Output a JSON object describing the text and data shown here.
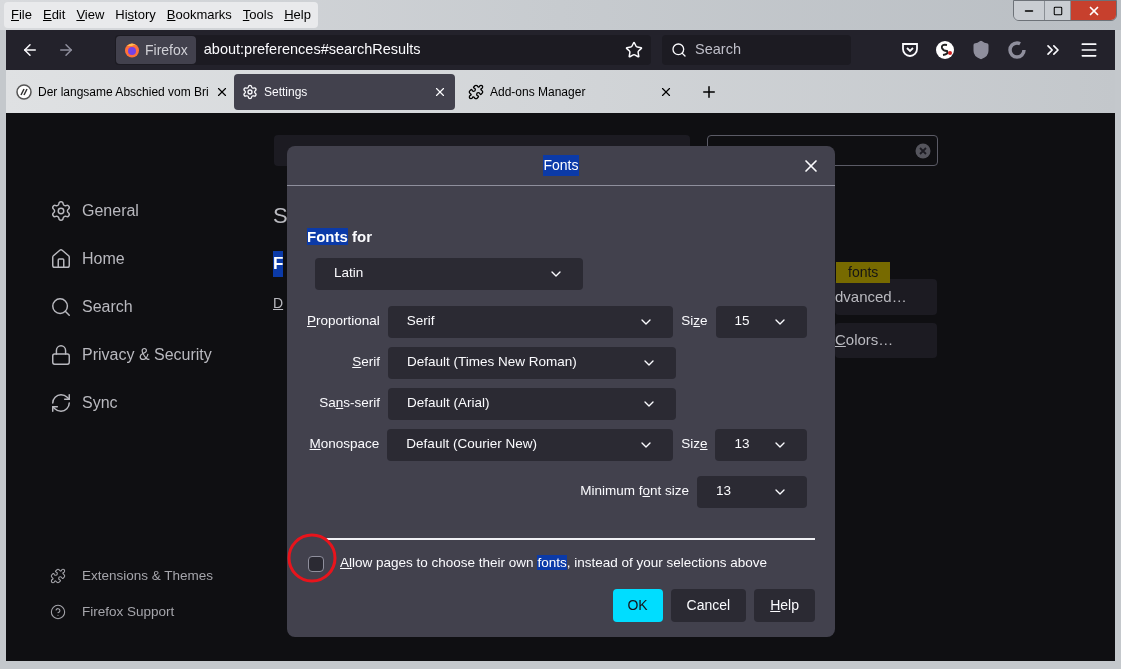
{
  "menu_bar": [
    {
      "label": [
        {
          "text": "F",
          "underlined": true
        },
        {
          "text": "ile",
          "underlined": false
        }
      ]
    },
    {
      "label": [
        {
          "text": "E",
          "underlined": true
        },
        {
          "text": "dit",
          "underlined": false
        }
      ]
    },
    {
      "label": [
        {
          "text": "V",
          "underlined": true
        },
        {
          "text": "iew",
          "underlined": false
        }
      ]
    },
    {
      "label": [
        {
          "text": "Hi",
          "underlined": false
        },
        {
          "text": "s",
          "underlined": true
        },
        {
          "text": "tory",
          "underlined": false
        }
      ]
    },
    {
      "label": [
        {
          "text": "B",
          "underlined": true
        },
        {
          "text": "ookmarks",
          "underlined": false
        }
      ]
    },
    {
      "label": [
        {
          "text": "T",
          "underlined": true
        },
        {
          "text": "ools",
          "underlined": false
        }
      ]
    },
    {
      "label": [
        {
          "text": "H",
          "underlined": true
        },
        {
          "text": "elp",
          "underlined": false
        }
      ]
    }
  ],
  "toolbar": {
    "back": {
      "disabled": false
    },
    "forward": {
      "disabled": true
    },
    "identity": "Firefox",
    "url": "about:preferences#searchResults",
    "search_placeholder": "Search"
  },
  "tabs": [
    {
      "title": "Der langsame Abschied vom Bri",
      "kind": "page",
      "selected": false
    },
    {
      "title": "Settings",
      "kind": "settings",
      "selected": true
    },
    {
      "title": "Add-ons Manager",
      "kind": "addons",
      "selected": false
    }
  ],
  "sidebar": {
    "items": [
      {
        "label": "General",
        "kind": "general"
      },
      {
        "label": "Home",
        "kind": "home"
      },
      {
        "label": "Search",
        "kind": "search"
      },
      {
        "label": "Privacy & Security",
        "kind": "privacy"
      },
      {
        "label": "Sync",
        "kind": "sync"
      }
    ],
    "footer": [
      {
        "label": "Extensions & Themes",
        "kind": "extensions"
      },
      {
        "label": "Firefox Support",
        "kind": "support"
      }
    ]
  },
  "page": {
    "heading": "S",
    "result_title": "F",
    "link": "D",
    "buttons": [
      {
        "label": [
          {
            "text": "dvanced…",
            "underlined": false
          }
        ]
      },
      {
        "label": [
          {
            "text": "C",
            "underlined": true
          },
          {
            "text": "olors…",
            "underlined": false
          }
        ]
      }
    ],
    "tooltip": "fonts"
  },
  "dialog": {
    "title": "Fonts",
    "title_highlighted": true,
    "fonts_for": [
      {
        "text": "Fonts",
        "highlighted": true
      },
      {
        "text": " for",
        "highlighted": false
      }
    ],
    "language": "Latin",
    "rows": [
      {
        "label": [
          {
            "text": "P",
            "underlined": true
          },
          {
            "text": "roportional",
            "underlined": false
          }
        ],
        "value": "Serif",
        "size": {
          "label": [
            {
              "text": "Si",
              "underlined": false
            },
            {
              "text": "z",
              "underlined": true
            },
            {
              "text": "e",
              "underlined": false
            }
          ],
          "value": "15"
        }
      },
      {
        "label": [
          {
            "text": "S",
            "underlined": true
          },
          {
            "text": "erif",
            "underlined": false
          }
        ],
        "value": "Default (Times New Roman)"
      },
      {
        "label": [
          {
            "text": "Sa",
            "underlined": false
          },
          {
            "text": "n",
            "underlined": true
          },
          {
            "text": "s-serif",
            "underlined": false
          }
        ],
        "value": "Default (Arial)"
      },
      {
        "label": [
          {
            "text": "M",
            "underlined": true
          },
          {
            "text": "onospace",
            "underlined": false
          }
        ],
        "value": "Default (Courier New)",
        "size": {
          "label": [
            {
              "text": "Siz",
              "underlined": false
            },
            {
              "text": "e",
              "underlined": true
            }
          ],
          "value": "13"
        }
      }
    ],
    "minimum_font_size": {
      "label": [
        {
          "text": "Minimum f",
          "underlined": false
        },
        {
          "text": "o",
          "underlined": true
        },
        {
          "text": "nt size",
          "underlined": false
        }
      ],
      "value": "13"
    },
    "allow_own_fonts": {
      "checked": false,
      "parts": [
        {
          "text": "A",
          "highlighted": false,
          "underlined": true
        },
        {
          "text": "l",
          "highlighted": false,
          "underlined": true
        },
        {
          "text": "low pages to choose their own ",
          "highlighted": false,
          "underlined": false
        },
        {
          "text": "fonts",
          "highlighted": true,
          "underlined": false
        },
        {
          "text": ", instead of your selections above",
          "highlighted": false,
          "underlined": false
        }
      ]
    },
    "buttons": [
      {
        "label": [
          {
            "text": "OK",
            "underlined": false
          }
        ],
        "kind": "primary"
      },
      {
        "label": [
          {
            "text": "Cancel",
            "underlined": false
          }
        ],
        "kind": "secondary"
      },
      {
        "label": [
          {
            "text": "H",
            "underlined": true
          },
          {
            "text": "elp",
            "underlined": false
          }
        ],
        "kind": "secondary"
      }
    ]
  }
}
